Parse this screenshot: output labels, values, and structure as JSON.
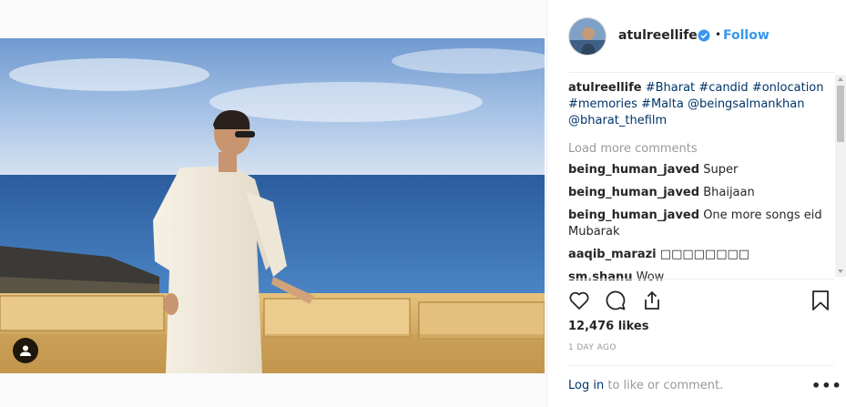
{
  "post": {
    "image_alt": "",
    "tag_icon": "user-tag-icon"
  },
  "header": {
    "username": "atulreellife",
    "verified_icon": "verified-badge-icon",
    "separator": "•",
    "follow_label": "Follow"
  },
  "caption": {
    "username": "atulreellife",
    "parts": [
      "#Bharat",
      "#candid",
      "#onlocation",
      "#memories",
      "#Malta",
      "@beingsalmankhan",
      "@bharat_thefilm"
    ]
  },
  "load_more_label": "Load more comments",
  "comments": [
    {
      "user": "being_human_javed",
      "text": "Super"
    },
    {
      "user": "being_human_javed",
      "text": "Bhaijaan"
    },
    {
      "user": "being_human_javed",
      "text": "One more songs eid Mubarak"
    },
    {
      "user": "aaqib_marazi",
      "text": "□□□□□□□□"
    },
    {
      "user": "sm.shanu",
      "text": "Wow"
    }
  ],
  "actions": {
    "like_icon": "heart-icon",
    "comment_icon": "comment-icon",
    "share_icon": "share-icon",
    "save_icon": "bookmark-icon"
  },
  "likes_text": "12,476 likes",
  "timestamp": "1 DAY AGO",
  "login": {
    "link": "Log in",
    "rest": "to like or comment.",
    "more": "•••"
  },
  "colors": {
    "link_blue": "#3897f0",
    "tag_dark_blue": "#003569",
    "muted": "#999999"
  }
}
